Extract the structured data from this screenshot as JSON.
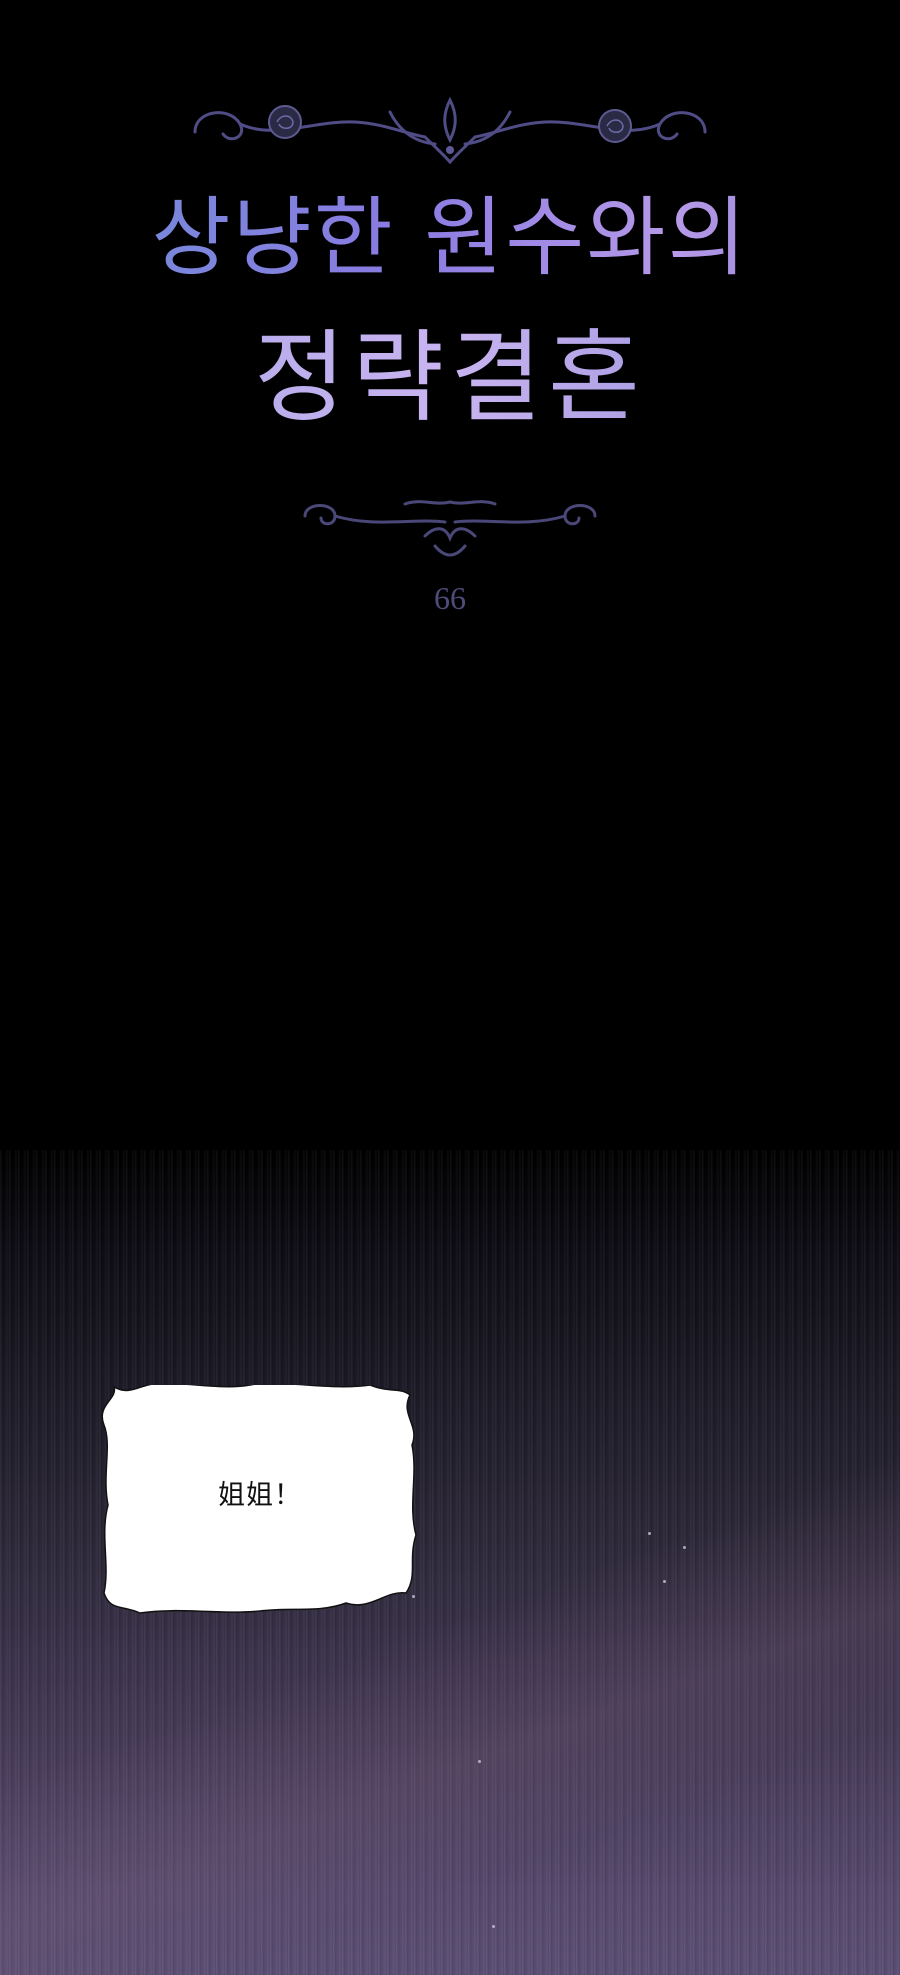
{
  "title": {
    "line1": "상냥한 원수와의",
    "line2": "정략결혼"
  },
  "episode": {
    "number": "66"
  },
  "dialogue": {
    "bubble_text": "姐姐！"
  },
  "colors": {
    "background": "#000000",
    "title_blue": "#6f8fd6",
    "title_purple": "#b79ae8",
    "scene_purple": "#5b4f74",
    "bubble_fill": "#ffffff"
  },
  "icons": {
    "top_ornament": "rose-scroll-ornament-icon",
    "bottom_ornament": "swirl-ornament-icon"
  }
}
